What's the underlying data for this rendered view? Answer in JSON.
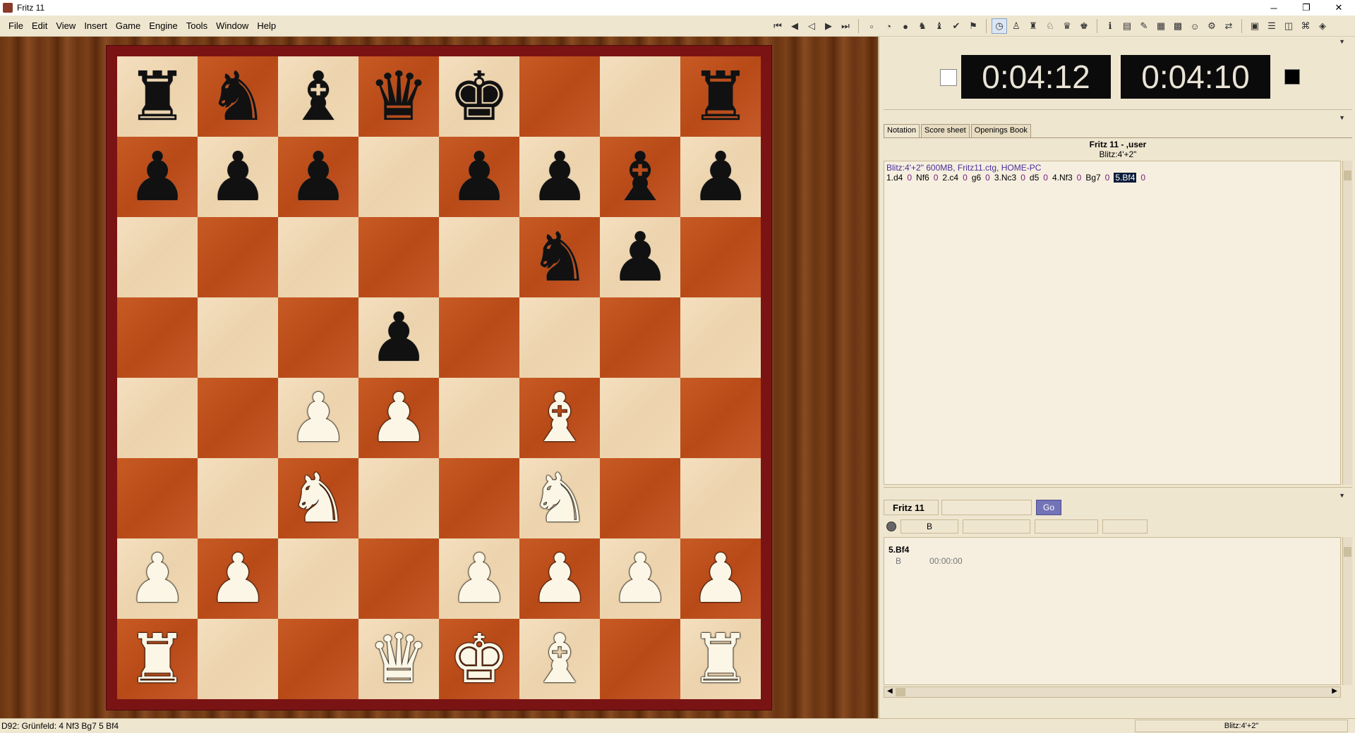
{
  "window": {
    "title": "Fritz 11",
    "minimize": "─",
    "maximize": "❐",
    "close": "✕"
  },
  "menu": [
    "File",
    "Edit",
    "View",
    "Insert",
    "Game",
    "Engine",
    "Tools",
    "Window",
    "Help"
  ],
  "toolbar": {
    "nav_icons": [
      "first-move-icon",
      "back-icon",
      "back-variation-icon",
      "forward-icon",
      "last-move-icon"
    ],
    "game_icons": [
      "new-game-icon",
      "clock-icon",
      "hint-icon",
      "engine-icon",
      "book-icon",
      "check-icon",
      "flag-icon"
    ],
    "view_icons": [
      "clock-active-icon",
      "coach-icon",
      "training-icon",
      "analysis-icon",
      "infinite-icon",
      "kibitz-icon"
    ],
    "misc_icons": [
      "info-icon",
      "open-book-icon",
      "pen-icon",
      "board-icon",
      "board2-icon",
      "player-icon",
      "settings-icon",
      "link-icon"
    ],
    "file_icons": [
      "save-icon",
      "list-icon",
      "layout-icon",
      "network-icon",
      "3d-icon"
    ]
  },
  "board": {
    "ranks": [
      [
        "br",
        "bn",
        "bb",
        "bq",
        "bk",
        "",
        "",
        "br"
      ],
      [
        "bp",
        "bp",
        "bp",
        "",
        "bp",
        "bp",
        "bb",
        "bp"
      ],
      [
        "",
        "",
        "",
        "",
        "",
        "bn",
        "bp",
        ""
      ],
      [
        "",
        "",
        "",
        "bp",
        "",
        "",
        "",
        ""
      ],
      [
        "",
        "",
        "wp",
        "wp",
        "",
        "wb",
        "",
        ""
      ],
      [
        "",
        "",
        "wn",
        "",
        "",
        "wn",
        "",
        ""
      ],
      [
        "wp",
        "wp",
        "",
        "",
        "wp",
        "wp",
        "wp",
        "wp"
      ],
      [
        "wr",
        "",
        "",
        "wq",
        "wk",
        "wb",
        "",
        "wr"
      ]
    ],
    "colors": {
      "light": "#f1dab6",
      "dark": "#c05322",
      "frame": "#7a1414"
    }
  },
  "clocks": {
    "white": "0:04:12",
    "black": "0:04:10"
  },
  "notation": {
    "tabs": [
      "Notation",
      "Score sheet",
      "Openings Book"
    ],
    "header_title": "Fritz 11 - ,user",
    "header_sub": "Blitz:4'+2\"",
    "meta": "Blitz:4'+2\"   600MB, Fritz11.ctg, HOME-PC",
    "moves": [
      {
        "m": "1.d4",
        "e": "0"
      },
      {
        "m": "Nf6",
        "e": "0"
      },
      {
        "m": "2.c4",
        "e": "0"
      },
      {
        "m": "g6",
        "e": "0"
      },
      {
        "m": "3.Nc3",
        "e": "0"
      },
      {
        "m": "d5",
        "e": "0"
      },
      {
        "m": "4.Nf3",
        "e": "0"
      },
      {
        "m": "Bg7",
        "e": "0"
      },
      {
        "m": "5.Bf4",
        "e": "0",
        "current": true
      }
    ]
  },
  "engine": {
    "name": "Fritz 11",
    "go_label": "Go",
    "side_label": "B",
    "line_move": "5.Bf4",
    "line_side": "B",
    "line_time": "00:00:00"
  },
  "status": {
    "opening": "D92: Grünfeld: 4 Nf3 Bg7 5 Bf4",
    "time_control": "Blitz:4'+2\""
  }
}
